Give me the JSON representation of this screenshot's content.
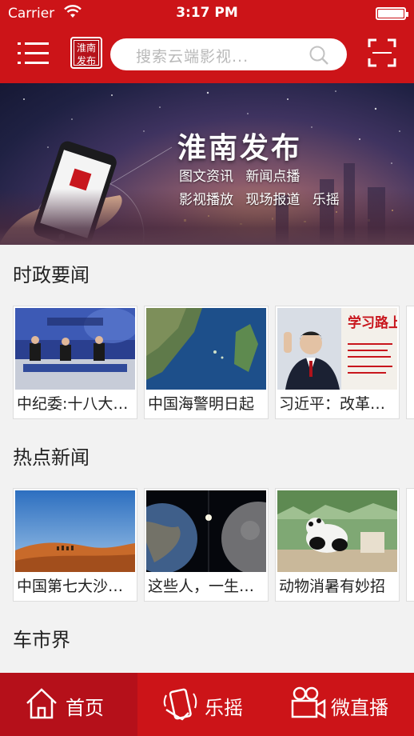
{
  "status": {
    "carrier": "Carrier",
    "time": "3:17 PM"
  },
  "header": {
    "logo_text": [
      "淮南",
      "发布"
    ],
    "search_placeholder": "搜索云端影视..."
  },
  "banner": {
    "title": "淮南发布",
    "links_row1": [
      "图文资讯",
      "新闻点播"
    ],
    "links_row2": [
      "影视播放",
      "现场报道",
      "乐摇"
    ]
  },
  "sections": [
    {
      "title": "时政要闻",
      "items": [
        {
          "caption": "中纪委:十八大以来"
        },
        {
          "caption": "中国海警明日起"
        },
        {
          "caption": "习近平：改革开放"
        }
      ]
    },
    {
      "title": "热点新闻",
      "items": [
        {
          "caption": "中国第七大沙漠现"
        },
        {
          "caption": "这些人，一生都在"
        },
        {
          "caption": "动物消暑有妙招"
        }
      ]
    },
    {
      "title": "车市界",
      "items": []
    }
  ],
  "tabs": [
    {
      "label": "首页",
      "icon": "home-icon",
      "active": true
    },
    {
      "label": "乐摇",
      "icon": "shake-phone-icon",
      "active": false
    },
    {
      "label": "微直播",
      "icon": "video-camera-icon",
      "active": false
    }
  ],
  "colors": {
    "brand_red": "#cc1418",
    "tab_active": "#b5101a"
  }
}
